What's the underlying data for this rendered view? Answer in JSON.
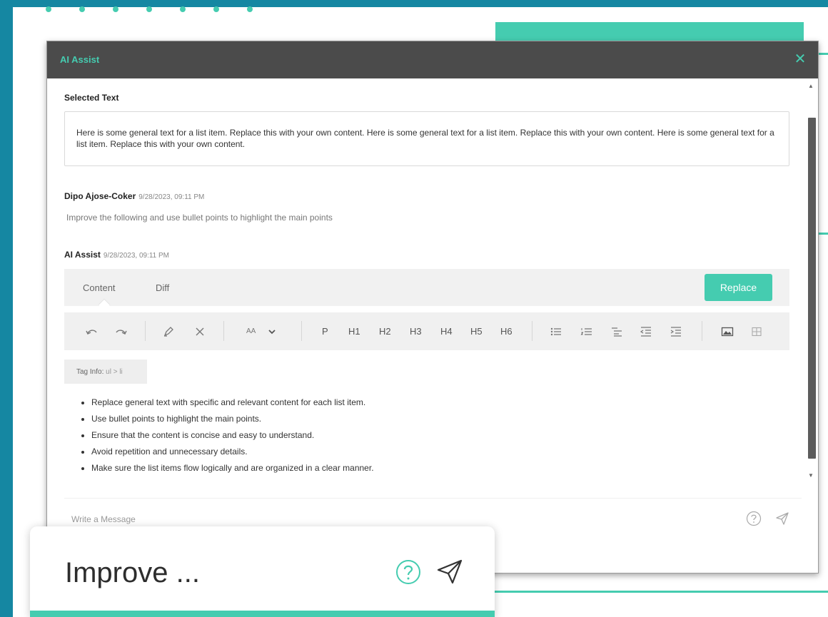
{
  "dialog": {
    "title": "AI Assist",
    "selected_label": "Selected Text",
    "selected_text": "Here is some general text for a list item. Replace this with your own content. Here is some general text for a list item. Replace this with your own content. Here is some general text for a list item. Replace this with your own content."
  },
  "user_message": {
    "author": "Dipo Ajose-Coker",
    "time": "9/28/2023, 09:11 PM",
    "text": "Improve the following and use bullet points to highlight the main points"
  },
  "assistant": {
    "author": "AI Assist",
    "time": "9/28/2023, 09:11 PM"
  },
  "tabs": {
    "content": "Content",
    "diff": "Diff",
    "replace": "Replace"
  },
  "toolbar": {
    "font_label": "AA",
    "headings": [
      "P",
      "H1",
      "H2",
      "H3",
      "H4",
      "H5",
      "H6"
    ]
  },
  "taginfo": {
    "label": "Tag Info:",
    "value": "ul > li"
  },
  "bullets": [
    "Replace general text with specific and relevant content for each list item.",
    "Use bullet points to highlight the main points.",
    "Ensure that the content is concise and easy to understand.",
    "Avoid repetition and unnecessary details.",
    "Make sure the list items flow logically and are organized in a clear manner."
  ],
  "composer": {
    "placeholder": "Write a Message"
  },
  "floating": {
    "text": "Improve ..."
  },
  "colors": {
    "accent": "#45ccb0",
    "background": "#1587a2",
    "titlebar": "#4b4b4b"
  }
}
